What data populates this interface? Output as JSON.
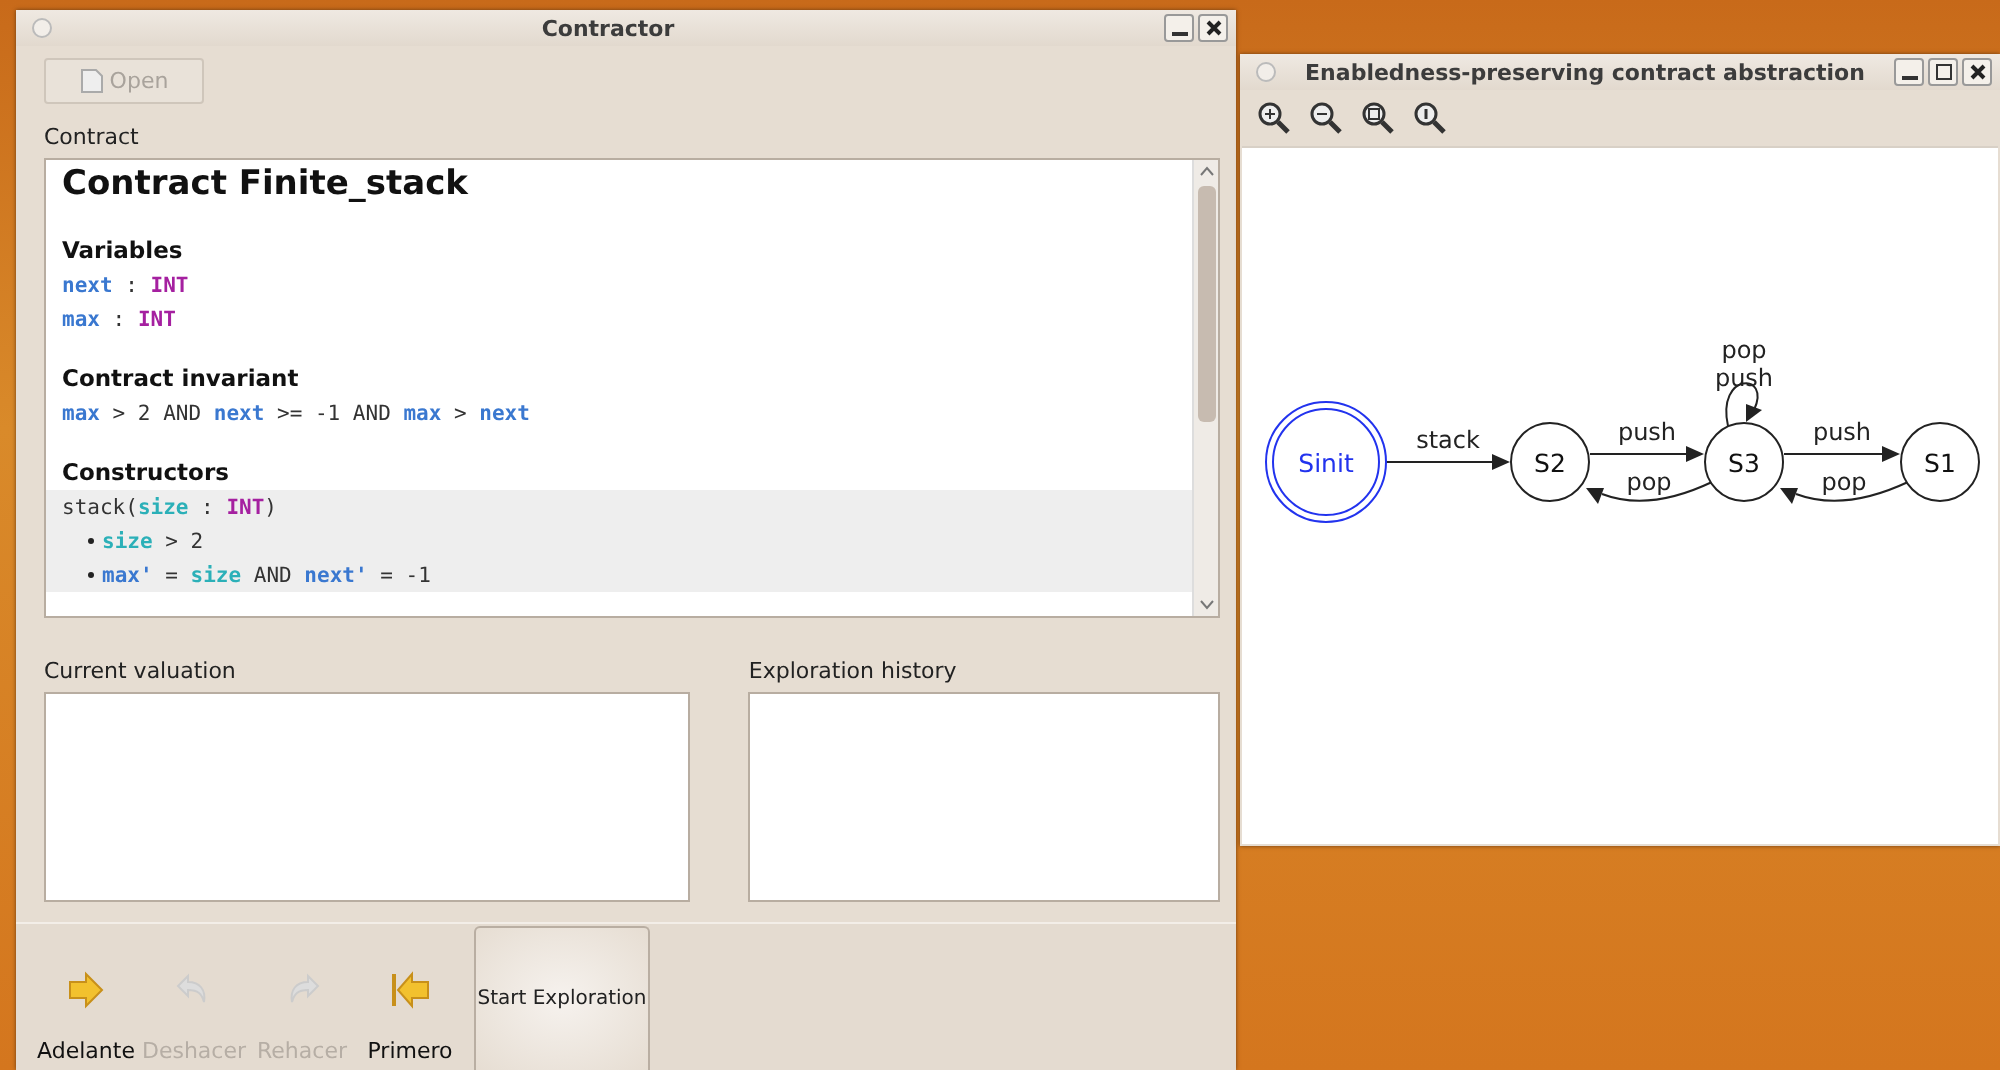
{
  "main_window": {
    "title": "Contractor",
    "open_button": {
      "label": "Open",
      "disabled": true
    },
    "contract_label": "Contract",
    "contract": {
      "title": "Contract Finite_stack",
      "sections": [
        {
          "heading": "Variables",
          "lines": [
            {
              "highlighted": false,
              "bullet": false,
              "segments": [
                {
                  "kind": "var",
                  "text": "next"
                },
                {
                  "kind": "plain",
                  "text": " : "
                },
                {
                  "kind": "type",
                  "text": "INT"
                }
              ]
            },
            {
              "highlighted": false,
              "bullet": false,
              "segments": [
                {
                  "kind": "var",
                  "text": "max"
                },
                {
                  "kind": "plain",
                  "text": " : "
                },
                {
                  "kind": "type",
                  "text": "INT"
                }
              ]
            }
          ]
        },
        {
          "heading": "Contract invariant",
          "lines": [
            {
              "highlighted": false,
              "bullet": false,
              "segments": [
                {
                  "kind": "var",
                  "text": "max"
                },
                {
                  "kind": "plain",
                  "text": " > 2 AND "
                },
                {
                  "kind": "var",
                  "text": "next"
                },
                {
                  "kind": "plain",
                  "text": " >= -1 AND "
                },
                {
                  "kind": "var",
                  "text": "max"
                },
                {
                  "kind": "plain",
                  "text": " > "
                },
                {
                  "kind": "var",
                  "text": "next"
                }
              ]
            }
          ]
        },
        {
          "heading": "Constructors",
          "lines": [
            {
              "highlighted": true,
              "bullet": false,
              "segments": [
                {
                  "kind": "plain",
                  "text": "stack("
                },
                {
                  "kind": "param",
                  "text": "size"
                },
                {
                  "kind": "plain",
                  "text": " : "
                },
                {
                  "kind": "type",
                  "text": "INT"
                },
                {
                  "kind": "plain",
                  "text": ")"
                }
              ]
            },
            {
              "highlighted": true,
              "bullet": true,
              "segments": [
                {
                  "kind": "param",
                  "text": "size"
                },
                {
                  "kind": "plain",
                  "text": " > 2"
                }
              ]
            },
            {
              "highlighted": true,
              "bullet": true,
              "segments": [
                {
                  "kind": "var",
                  "text": "max'"
                },
                {
                  "kind": "plain",
                  "text": " = "
                },
                {
                  "kind": "param",
                  "text": "size"
                },
                {
                  "kind": "plain",
                  "text": " AND "
                },
                {
                  "kind": "var",
                  "text": "next'"
                },
                {
                  "kind": "plain",
                  "text": " = -1"
                }
              ]
            }
          ]
        }
      ]
    },
    "valuation_label": "Current valuation",
    "history_label": "Exploration history",
    "toolbar": [
      {
        "label": "Adelante",
        "kind": "forward",
        "disabled": false
      },
      {
        "label": "Deshacer",
        "kind": "undo",
        "disabled": true
      },
      {
        "label": "Rehacer",
        "kind": "redo",
        "disabled": true
      },
      {
        "label": "Primero",
        "kind": "first",
        "disabled": false
      }
    ],
    "start_button": "Start Exploration"
  },
  "graph_window": {
    "title": "Enabledness-preserving contract abstraction",
    "nodes": [
      {
        "label": "Sinit",
        "initial": true
      },
      {
        "label": "S2",
        "initial": false
      },
      {
        "label": "S3",
        "initial": false
      },
      {
        "label": "S1",
        "initial": false
      }
    ],
    "edges": [
      {
        "kind": "forward",
        "labels": [
          "stack"
        ]
      },
      {
        "kind": "forward",
        "labels": [
          "push"
        ]
      },
      {
        "kind": "back",
        "labels": [
          "pop"
        ]
      },
      {
        "kind": "loop",
        "labels": [
          "pop",
          "push"
        ]
      },
      {
        "kind": "forward",
        "labels": [
          "push"
        ]
      },
      {
        "kind": "back",
        "labels": [
          "pop"
        ]
      }
    ]
  }
}
